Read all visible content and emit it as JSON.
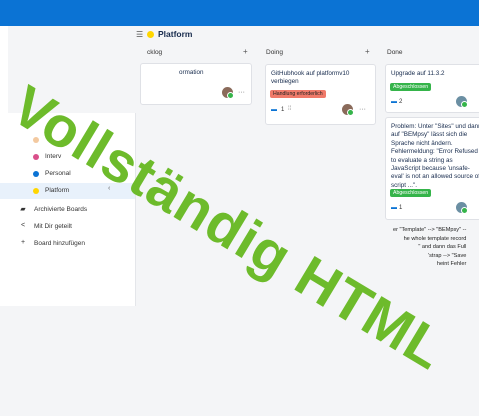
{
  "board": {
    "menu_icon": "hamburger-icon",
    "title": "Platform",
    "color": "#ffd600"
  },
  "sidebar": {
    "boards": [
      {
        "label": "",
        "color": "#f3c9a0"
      },
      {
        "label": "Interv",
        "color": "#d94f8a"
      },
      {
        "label": "Personal",
        "color": "#0b73d4"
      },
      {
        "label": "Platform",
        "color": "#ffd600",
        "active": true
      }
    ],
    "actions": [
      {
        "label": "Archivierte Boards",
        "icon": "archive-icon"
      },
      {
        "label": "Mit Dir geteilt",
        "icon": "share-icon"
      },
      {
        "label": "Board hinzufügen",
        "icon": "plus-icon"
      }
    ]
  },
  "columns": [
    {
      "title": "cklog",
      "add": "+"
    },
    {
      "title": "Doing",
      "add": "+"
    },
    {
      "title": "Done",
      "add": ""
    }
  ],
  "cards": {
    "backlog": {
      "text": "ormation",
      "menu": "···"
    },
    "doing": {
      "text": "GitHubhook auf platformv10 verbiegen",
      "tag": "Handlung erforderlich",
      "count": "1",
      "menu": "···"
    },
    "done1": {
      "text": "Upgrade auf 11.3.2",
      "tag": "Abgeschlossen",
      "count": "2"
    },
    "done2": {
      "text": "Problem: Unter \"Sites\" und dann auf \"BEMpsy\" lässt sich die Sprache nicht ändern. Fehlermeldung: \"Error Refused to evaluate a string as JavaScript because 'unsafe-eval' is not an allowed source of script ...\".",
      "tag": "Abgeschlossen",
      "count": "1"
    }
  },
  "code_lines": [
    "er \"Template\" --> \"BEMpsy\" --",
    "he whole template record",
    "\" and dann das Full",
    "'strap --> \"Save",
    "heint Fehler"
  ],
  "overlay_text": "Vollständig HTML",
  "colors": {
    "topbar": "#0b73d4",
    "overlay": "#6dbb2b",
    "tag_red": "#f07a6a",
    "tag_green": "#35b44a"
  }
}
